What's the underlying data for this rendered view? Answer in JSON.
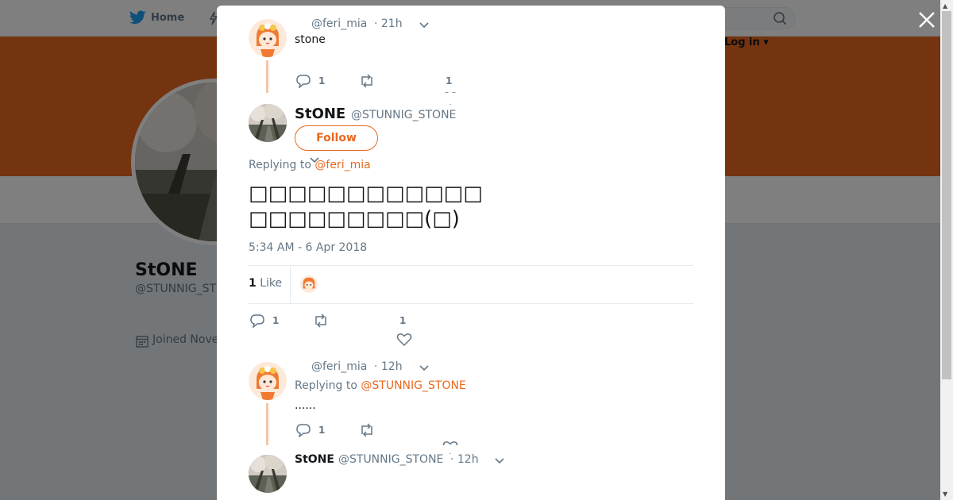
{
  "nav": {
    "home_label": "Home",
    "login_label": "Log in"
  },
  "profile": {
    "name": "StONE",
    "handle": "@STUNNIG_STONE",
    "joined": "Joined Nove",
    "banner_color": "#e8681e"
  },
  "modal": {
    "reply_tweet": {
      "handle": "@feri_mia",
      "time": "· 21h",
      "text": "stone",
      "reply_count": "1",
      "like_count": "1"
    },
    "main_tweet": {
      "name": "StONE",
      "handle": "@STUNNIG_STONE",
      "follow_label": "Follow",
      "replying_prefix": "Replying to ",
      "replying_to": "@feri_mia",
      "text_line1": "□□□□□□□□□□□□",
      "text_line2": "□□□□□□□□□(□)",
      "timestamp": "5:34 AM - 6 Apr 2018",
      "likes_count": "1",
      "likes_label": "Like",
      "reply_count": "1",
      "like_count": "1"
    },
    "reply2": {
      "handle": "@feri_mia",
      "time": "· 12h",
      "replying_prefix": "Replying to ",
      "replying_to": "@STUNNIG_STONE",
      "text": "......",
      "reply_count": "1"
    },
    "reply3": {
      "name": "StONE",
      "handle": "@STUNNIG_STONE",
      "time": "· 12h"
    }
  },
  "colors": {
    "accent": "#e8681e",
    "muted": "#657786",
    "thread_line": "#f8c5a8"
  },
  "icons": {
    "close": "close-icon",
    "reply": "reply-icon",
    "retweet": "retweet-icon",
    "like": "heart-icon",
    "caret": "chevron-down-icon"
  }
}
